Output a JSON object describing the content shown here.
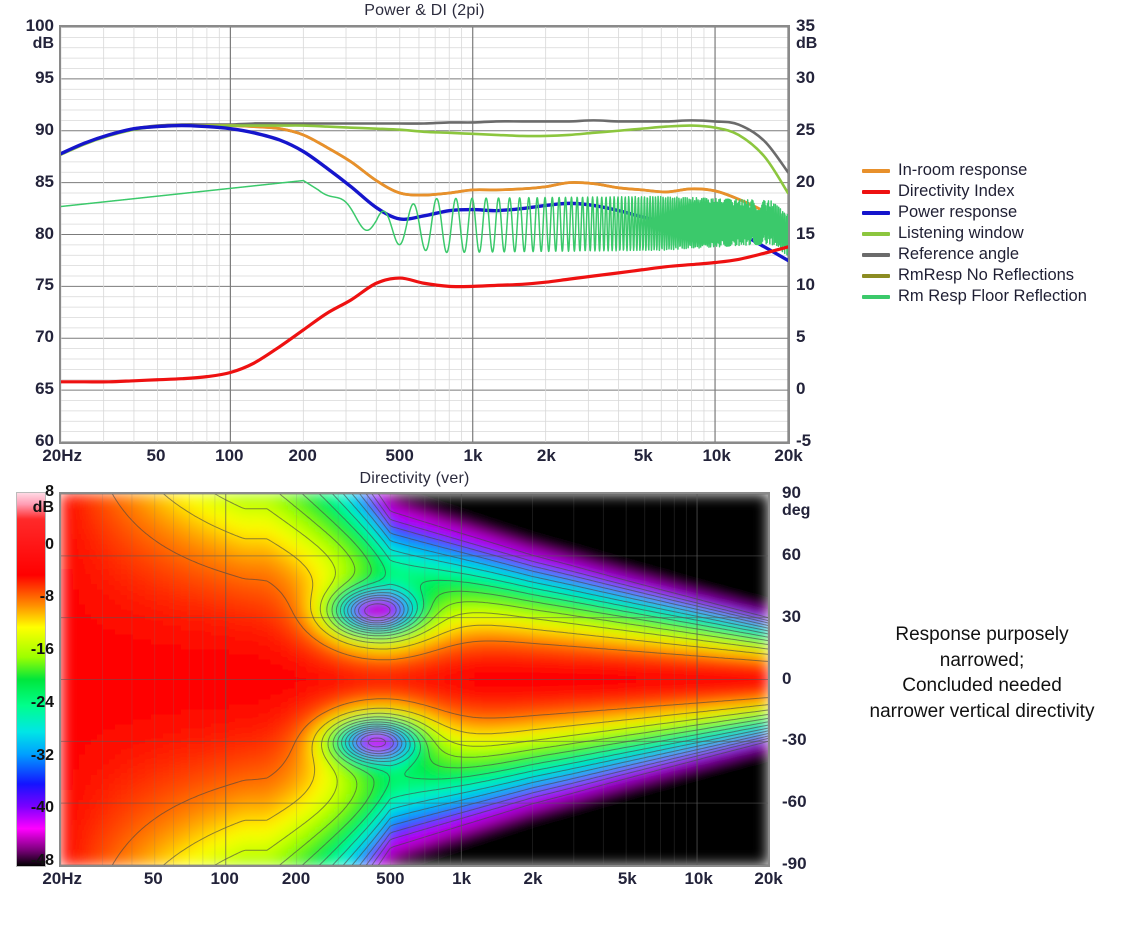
{
  "top_chart": {
    "title": "Power & DI (2pi)",
    "y_left": {
      "unit": "dB",
      "ticks": [
        100,
        95,
        90,
        85,
        80,
        75,
        70,
        65,
        60
      ]
    },
    "y_right": {
      "unit": "dB",
      "ticks": [
        35,
        30,
        25,
        20,
        15,
        10,
        5,
        0,
        -5
      ]
    },
    "x_ticks": [
      "20Hz",
      "50",
      "100",
      "200",
      "500",
      "1k",
      "2k",
      "5k",
      "10k",
      "20k"
    ]
  },
  "legend": {
    "items": [
      {
        "label": "In-room response",
        "color": "#E8902B"
      },
      {
        "label": "Directivity Index",
        "color": "#EE1111"
      },
      {
        "label": "Power response",
        "color": "#1515CC"
      },
      {
        "label": "Listening window",
        "color": "#8CC63E"
      },
      {
        "label": "Reference angle",
        "color": "#6B6B6B"
      },
      {
        "label": "RmResp No Reflections",
        "color": "#8C8C22"
      },
      {
        "label": "Rm Resp Floor Reflection",
        "color": "#3BC96B"
      }
    ]
  },
  "bottom_chart": {
    "title": "Directivity (ver)",
    "colorbar": {
      "unit": "dB",
      "ticks": [
        8,
        0,
        -8,
        -16,
        -24,
        -32,
        -40,
        -48
      ]
    },
    "y_right": {
      "unit": "deg",
      "ticks": [
        90,
        60,
        30,
        0,
        -30,
        -60,
        -90
      ]
    },
    "x_ticks": [
      "20Hz",
      "50",
      "100",
      "200",
      "500",
      "1k",
      "2k",
      "5k",
      "10k",
      "20k"
    ]
  },
  "annotation": {
    "line1": "Response purposely",
    "line2": "narrowed;",
    "line3": "Concluded needed",
    "line4": "narrower vertical directivity"
  },
  "chart_data": [
    {
      "type": "line",
      "title": "Power & DI (2pi)",
      "xlabel": "",
      "ylabel": "dB",
      "xscale": "log",
      "xlim": [
        20,
        20000
      ],
      "ylim": [
        60,
        100
      ],
      "y2lim": [
        -5,
        35
      ],
      "grid": true,
      "legend_position": "right-outside",
      "x": [
        20,
        25,
        31.5,
        40,
        50,
        63,
        80,
        100,
        125,
        160,
        200,
        250,
        315,
        400,
        500,
        630,
        800,
        1000,
        1250,
        1600,
        2000,
        2500,
        3150,
        4000,
        5000,
        6300,
        8000,
        10000,
        12500,
        16000,
        20000
      ],
      "series": [
        {
          "name": "Reference angle",
          "axis": "left",
          "color": "#6B6B6B",
          "values": [
            87.8,
            88.8,
            89.6,
            90.2,
            90.5,
            90.6,
            90.6,
            90.6,
            90.7,
            90.7,
            90.7,
            90.7,
            90.7,
            90.7,
            90.7,
            90.7,
            90.8,
            90.8,
            90.9,
            90.9,
            90.9,
            90.9,
            91.0,
            90.9,
            90.9,
            90.9,
            91.0,
            90.9,
            90.6,
            89.0,
            86.0
          ]
        },
        {
          "name": "RmResp No Reflections",
          "axis": "left",
          "color": "#8C8C22",
          "values": [
            87.8,
            88.8,
            89.6,
            90.2,
            90.4,
            90.5,
            90.5,
            90.5,
            90.4,
            90.2,
            89.6,
            88.4,
            87.0,
            85.2,
            84.0,
            83.8,
            84.0,
            84.3,
            84.3,
            84.4,
            84.6,
            85.0,
            84.9,
            84.5,
            84.3,
            84.1,
            84.4,
            84.2,
            83.4,
            82.2,
            80.6
          ]
        },
        {
          "name": "In-room response",
          "axis": "left",
          "color": "#E8902B",
          "values": [
            87.8,
            88.8,
            89.6,
            90.2,
            90.4,
            90.5,
            90.5,
            90.5,
            90.4,
            90.2,
            89.6,
            88.4,
            87.0,
            85.2,
            84.0,
            83.8,
            84.0,
            84.3,
            84.3,
            84.4,
            84.6,
            85.0,
            84.9,
            84.5,
            84.3,
            84.1,
            84.4,
            84.2,
            83.4,
            82.2,
            80.6
          ]
        },
        {
          "name": "Listening window",
          "axis": "left",
          "color": "#8CC63E",
          "values": [
            87.7,
            88.7,
            89.5,
            90.1,
            90.4,
            90.5,
            90.5,
            90.5,
            90.5,
            90.5,
            90.5,
            90.4,
            90.3,
            90.2,
            90.1,
            89.9,
            89.8,
            89.7,
            89.6,
            89.5,
            89.5,
            89.6,
            89.8,
            90.0,
            90.2,
            90.4,
            90.5,
            90.3,
            89.6,
            87.5,
            84.0
          ]
        },
        {
          "name": "Power response",
          "axis": "left",
          "color": "#1515CC",
          "values": [
            87.8,
            88.8,
            89.6,
            90.2,
            90.4,
            90.5,
            90.4,
            90.2,
            89.8,
            89.1,
            88.0,
            86.4,
            84.6,
            82.6,
            81.5,
            81.8,
            82.3,
            82.4,
            82.3,
            82.5,
            82.8,
            83.0,
            82.8,
            82.3,
            81.7,
            81.2,
            81.3,
            81.1,
            80.2,
            78.8,
            77.5
          ]
        },
        {
          "name": "Rm Resp Floor Reflection",
          "axis": "left",
          "color": "#3BC96B",
          "values": [
            82.7,
            83.9,
            84.8,
            85.2,
            85.3,
            85.2,
            85.1,
            85.0,
            84.9,
            84.7,
            83.9,
            82.3,
            80.5,
            81.4,
            78.6,
            83.0,
            78.2,
            82.8,
            78.3,
            83.0,
            78.6,
            82.9,
            79.0,
            82.4,
            79.3,
            82.0,
            79.6,
            81.5,
            80.0,
            80.4,
            78.8
          ]
        },
        {
          "name": "Directivity Index",
          "axis": "right",
          "color": "#EE1111",
          "values": [
            0.8,
            0.8,
            0.8,
            0.9,
            1.0,
            1.1,
            1.3,
            1.7,
            2.6,
            4.2,
            5.8,
            7.4,
            8.7,
            10.3,
            10.8,
            10.3,
            10.0,
            10.0,
            10.1,
            10.2,
            10.4,
            10.7,
            11.0,
            11.3,
            11.6,
            11.9,
            12.1,
            12.3,
            12.6,
            13.2,
            13.8
          ]
        }
      ]
    },
    {
      "type": "heatmap",
      "title": "Directivity (ver)",
      "xlabel": "",
      "ylabel": "deg",
      "xscale": "log",
      "xlim": [
        20,
        20000
      ],
      "ylim": [
        -90,
        90
      ],
      "zlim": [
        -48,
        8
      ],
      "zlabel": "dB",
      "colormap": "white-red-yellow-green-cyan-blue-magenta-black",
      "grid": true,
      "description": "Vertical directivity contour: broad red on-axis lobe to ~200Hz across all angles; deep nulls (blue, about -32 dB) near 400-500 Hz at +33 deg and -30 deg; progressive narrowing of the red main lobe above 2 kHz, reaching roughly +/-20 deg at 20 kHz with blue/violet (-32 to -48 dB) at +/-90 deg."
    }
  ]
}
